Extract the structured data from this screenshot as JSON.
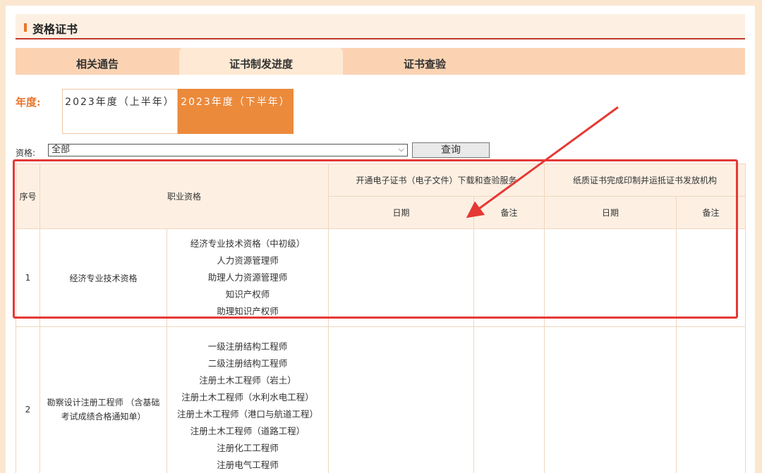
{
  "section": {
    "title": "资格证书"
  },
  "tabs": [
    {
      "label": "相关通告"
    },
    {
      "label": "证书制发进度"
    },
    {
      "label": "证书查验"
    }
  ],
  "year": {
    "label": "年度:",
    "options": [
      {
        "label": "2023年度（上半年）"
      },
      {
        "label": "2023年度（下半年）"
      }
    ]
  },
  "filter": {
    "label": "资格:",
    "selected": "全部",
    "button": "查询"
  },
  "table": {
    "headers": {
      "seq": "序号",
      "qualification": "职业资格",
      "electronic": "开通电子证书（电子文件）下载和查验服务",
      "paper": "纸质证书完成印制并运抵证书发放机构",
      "date": "日期",
      "remark": "备注"
    },
    "rows": [
      {
        "seq": "1",
        "category": "经济专业技术资格",
        "items": "经济专业技术资格（中初级）\n人力资源管理师\n助理人力资源管理师\n知识产权师\n助理知识产权师"
      },
      {
        "seq": "2",
        "category": "勘察设计注册工程师 （含基础考试成绩合格通知单）",
        "items": "一级注册结构工程师\n二级注册结构工程师\n注册土木工程师（岩土）\n注册土木工程师（水利水电工程）\n注册土木工程师（港口与航道工程）\n注册土木工程师（道路工程）\n注册化工工程师\n注册电气工程师\n注册公用设备工程师"
      }
    ]
  }
}
